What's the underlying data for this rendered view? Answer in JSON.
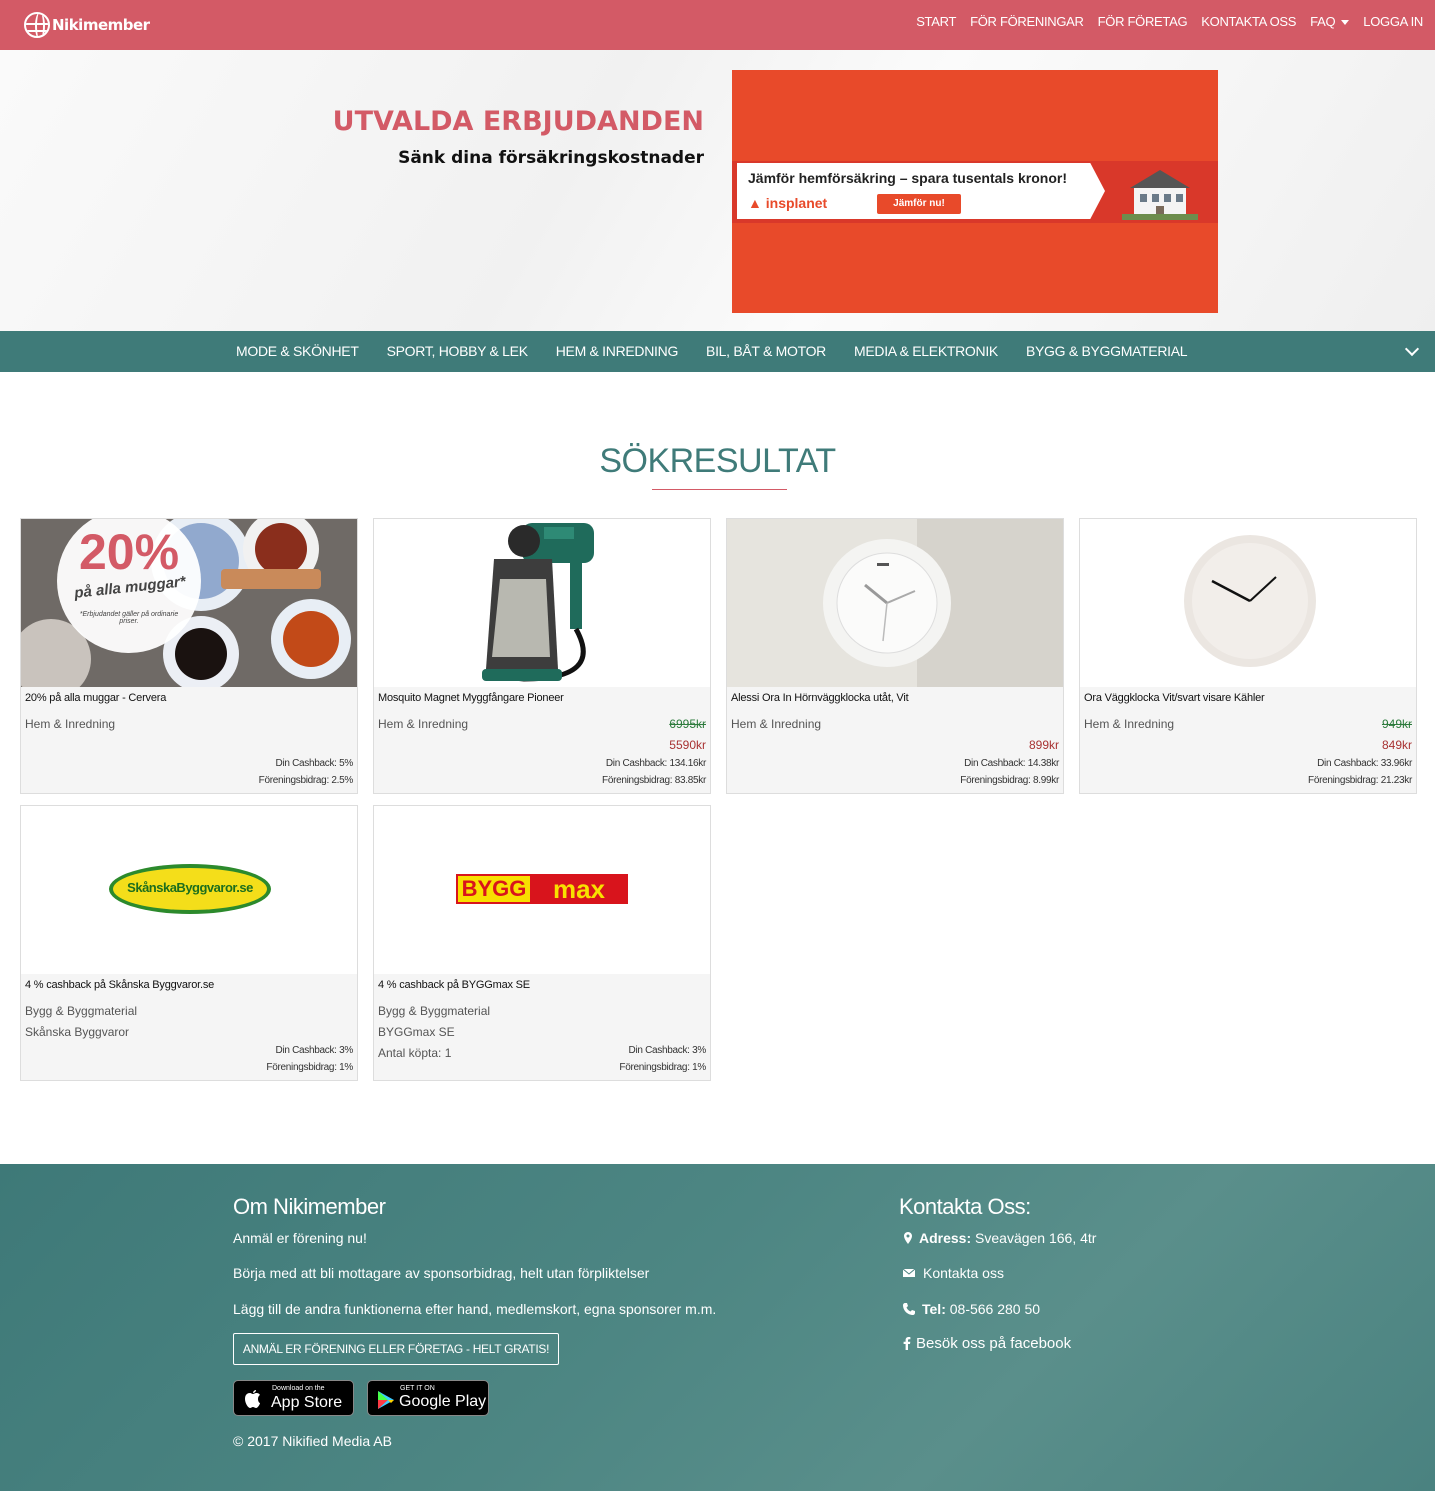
{
  "brand": {
    "name": "Nikimember"
  },
  "topnav": [
    {
      "label": "START"
    },
    {
      "label": "FÖR FÖRENINGAR"
    },
    {
      "label": "FÖR FÖRETAG"
    },
    {
      "label": "KONTAKTA OSS"
    },
    {
      "label": "FAQ"
    },
    {
      "label": "LOGGA IN"
    }
  ],
  "hero": {
    "title": "UTVALDA ERBJUDANDEN",
    "subtitle": "Sänk dina försäkringskostnader",
    "banner": {
      "headline": "Jämför hemförsäkring – spara tusentals kronor!",
      "brand": "insplanet",
      "cta": "Jämför nu!"
    }
  },
  "categories": [
    {
      "label": "MODE & SKÖNHET"
    },
    {
      "label": "SPORT, HOBBY & LEK"
    },
    {
      "label": "HEM & INREDNING"
    },
    {
      "label": "BIL, BÅT & MOTOR"
    },
    {
      "label": "MEDIA & ELEKTRONIK"
    },
    {
      "label": "BYGG & BYGGMATERIAL"
    }
  ],
  "results": {
    "title": "SÖKRESULTAT",
    "items": [
      {
        "title": "20% på alla muggar - Cervera",
        "category": "Hem & Inredning",
        "old_price": "",
        "price": "",
        "cashback": "Din Cashback: 5%",
        "bidrag": "Föreningsbidrag: 2.5%",
        "image": "mugs-promo",
        "promo_big": "20%",
        "promo_line": "på alla muggar*",
        "promo_note": "*Erbjudandet gäller på ordinarie priser."
      },
      {
        "title": "Mosquito Magnet Myggfångare Pioneer",
        "category": "Hem & Inredning",
        "old_price": "6995kr",
        "price": "5590kr",
        "cashback": "Din Cashback: 134.16kr",
        "bidrag": "Föreningsbidrag: 83.85kr",
        "image": "mosquito-trap"
      },
      {
        "title": "Alessi Ora In Hörnväggklocka utåt, Vit",
        "category": "Hem & Inredning",
        "old_price": "",
        "price": "899kr",
        "cashback": "Din Cashback: 14.38kr",
        "bidrag": "Föreningsbidrag: 8.99kr",
        "image": "corner-clock"
      },
      {
        "title": "Ora Väggklocka Vit/svart visare Kähler",
        "category": "Hem & Inredning",
        "old_price": "949kr",
        "price": "849kr",
        "cashback": "Din Cashback: 33.96kr",
        "bidrag": "Föreningsbidrag: 21.23kr",
        "image": "wall-clock"
      },
      {
        "title": "4 % cashback på Skånska Byggvaror.se",
        "category": "Bygg & Byggmaterial",
        "store": "Skånska Byggvaror",
        "bought": "",
        "cashback": "Din Cashback: 3%",
        "bidrag": "Föreningsbidrag: 1%",
        "image": "skanska-logo",
        "logo_text": "SkånskaByggvaror.se"
      },
      {
        "title": "4 % cashback på BYGGmax SE",
        "category": "Bygg & Byggmaterial",
        "store": "BYGGmax SE",
        "bought": "Antal köpta: 1",
        "cashback": "Din Cashback: 3%",
        "bidrag": "Föreningsbidrag: 1%",
        "image": "byggmax-logo",
        "logo_a": "BYGG",
        "logo_b": "max"
      }
    ]
  },
  "footer": {
    "about_title": "Om Nikimember",
    "about_lines": [
      "Anmäl er förening nu!",
      "Börja med att bli mottagare av sponsorbidrag, helt utan förpliktelser",
      "Lägg till de andra funktionerna efter hand, medlemskort, egna sponsorer m.m."
    ],
    "signup_button": "ANMÄL ER FÖRENING ELLER FÖRETAG - HELT GRATIS!",
    "appstore_small": "Download on the",
    "appstore_big": "App Store",
    "googleplay_small": "GET IT ON",
    "googleplay_big": "Google Play",
    "copyright": "© 2017 Nikified Media AB",
    "contact_title": "Kontakta Oss:",
    "address_label": "Adress:",
    "address": "Sveavägen 166, 4tr",
    "contact_link": "Kontakta oss",
    "tel_label": "Tel:",
    "tel": "08-566 280 50",
    "facebook": "Besök oss på facebook"
  },
  "colors": {
    "brand": "#d35a66",
    "teal": "#3f7b79",
    "price_old": "#2c7b3c",
    "price_new": "#a83232"
  }
}
